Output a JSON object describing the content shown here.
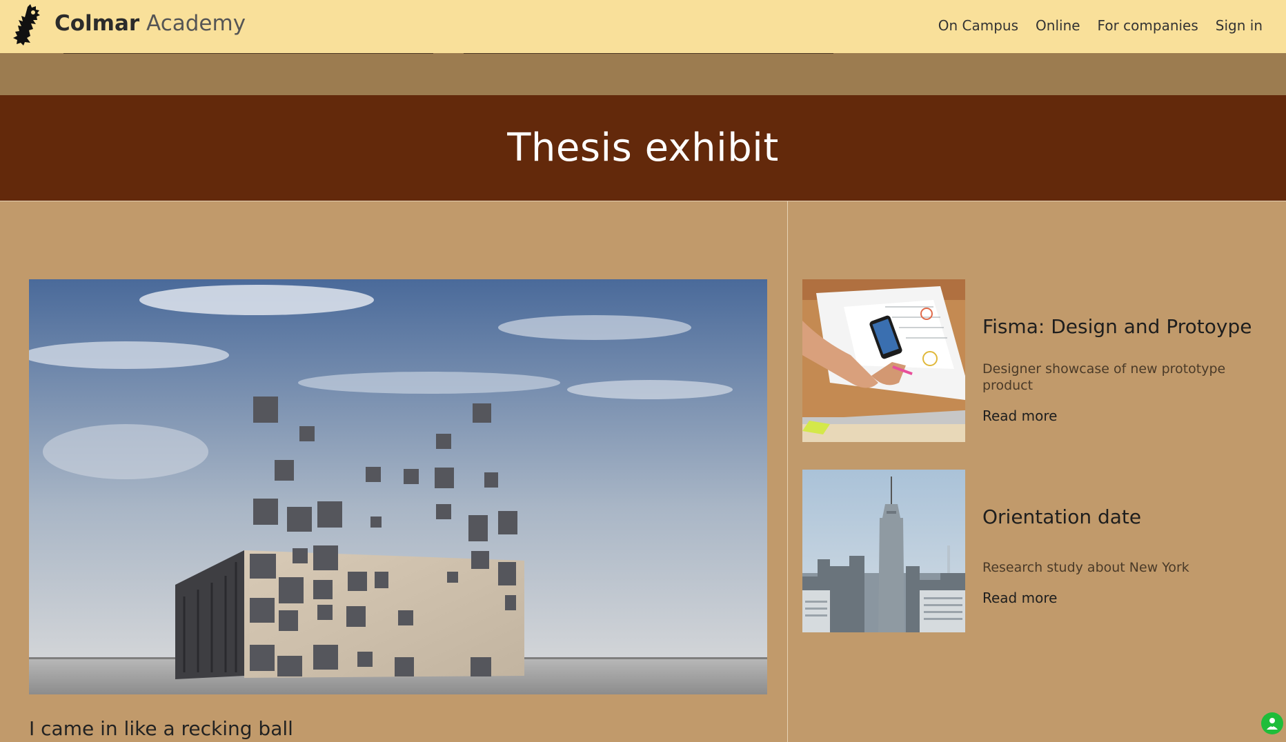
{
  "header": {
    "brand": "Colmar",
    "brand_suffix": "Academy",
    "nav": [
      {
        "label": "On Campus"
      },
      {
        "label": "Online"
      },
      {
        "label": "For companies"
      },
      {
        "label": "Sign in"
      }
    ]
  },
  "banner": {
    "title": "Thesis exhibit"
  },
  "main": {
    "hero_caption": "I came in like a recking ball"
  },
  "cards": [
    {
      "title": "Fisma: Design and Protoype",
      "description": "Designer showcase of new prototype product",
      "link": "Read more"
    },
    {
      "title": "Orientation date",
      "description": "Research study about New York",
      "link": "Read more"
    }
  ],
  "colors": {
    "header_bg": "#f9e09a",
    "band_bg": "#9c7c50",
    "title_bg": "#63290b",
    "page_bg": "#c19a6b",
    "fab": "#1fbd3a"
  },
  "icons": {
    "logo": "lion-rampant-icon",
    "fab": "user-plus-icon"
  }
}
